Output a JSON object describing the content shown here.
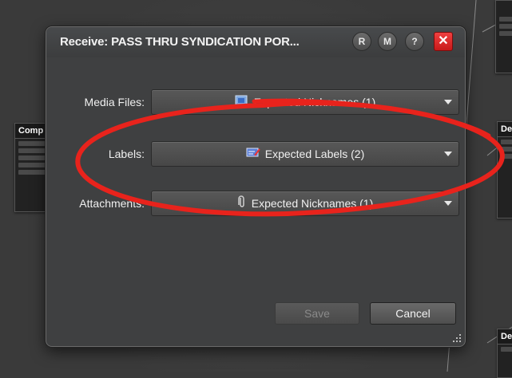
{
  "dialog": {
    "title": "Receive: PASS THRU SYNDICATION POR...",
    "buttons": {
      "r": "R",
      "m": "M",
      "help": "?",
      "close": "✕"
    },
    "fields": [
      {
        "label": "Media Files:",
        "value": "Expected Nicknames (1)",
        "icon": "media-files-icon"
      },
      {
        "label": "Labels:",
        "value": "Expected Labels (2)",
        "icon": "labels-icon"
      },
      {
        "label": "Attachments:",
        "value": "Expected Nicknames (1)",
        "icon": "paperclip-icon"
      }
    ],
    "save_label": "Save",
    "cancel_label": "Cancel"
  },
  "background": {
    "node_left_title": "Comp",
    "node_right_mid_title": "De",
    "node_right_bottom_title": "De"
  },
  "colors": {
    "annotation": "#e8231c",
    "close_button": "#e02a2a"
  }
}
